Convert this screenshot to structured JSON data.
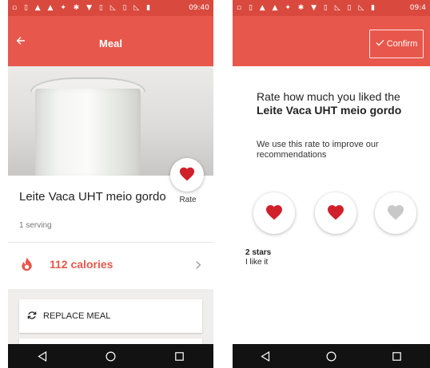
{
  "colors": {
    "accent": "#e8574b",
    "status_bar": "#d9493e",
    "heart_active": "#d0202b",
    "heart_inactive": "#c8c8c8",
    "nav_bar": "#121212"
  },
  "status_bar": {
    "time_left": "09:40",
    "time_right": "09:4"
  },
  "meal_screen": {
    "title": "Meal",
    "back_icon": "arrow-back-icon",
    "rate_label": "Rate",
    "meal_name": "Leite Vaca UHT meio gordo",
    "serving": "1 serving",
    "calories_label": "112 calories",
    "calories_icon": "flame-icon",
    "replace_label": "REPLACE MEAL",
    "replace_icon": "refresh-icon"
  },
  "rate_screen": {
    "confirm_label": "Confirm",
    "question_prefix": "Rate how much you liked the ",
    "question_bold": "Leite Vaca UHT meio gordo",
    "subtitle": "We use this rate to improve our recommendations",
    "rating_max": 3,
    "rating_selected": 2,
    "rating_title": "2 stars",
    "rating_description": "I like it"
  },
  "nav_bar": {
    "back_icon": "nav-back-icon",
    "home_icon": "nav-home-icon",
    "recents_icon": "nav-recents-icon"
  }
}
